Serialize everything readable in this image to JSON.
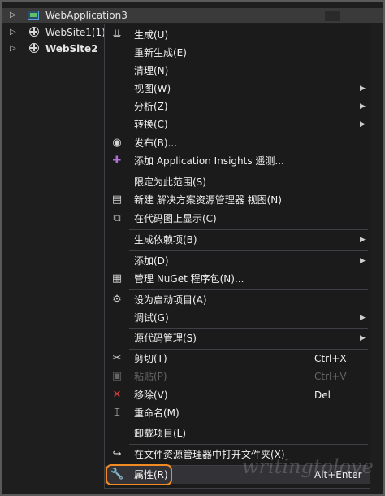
{
  "tree": {
    "app": "WebApplication3",
    "site1": "WebSite1(1)",
    "site2": "WebSite2"
  },
  "menu": {
    "build": "生成(U)",
    "rebuild": "重新生成(E)",
    "clean": "清理(N)",
    "view": "视图(W)",
    "analyze": "分析(Z)",
    "convert": "转换(C)",
    "publish": "发布(B)...",
    "insights": "添加 Application Insights 遥测...",
    "scope": "限定为此范围(S)",
    "new_view": "新建 解决方案资源管理器 视图(N)",
    "code_map": "在代码图上显示(C)",
    "build_deps": "生成依赖项(B)",
    "add": "添加(D)",
    "nuget": "管理 NuGet 程序包(N)...",
    "startup": "设为启动项目(A)",
    "debug": "调试(G)",
    "source_control": "源代码管理(S)",
    "cut": "剪切(T)",
    "cut_sc": "Ctrl+X",
    "paste": "粘贴(P)",
    "paste_sc": "Ctrl+V",
    "remove": "移除(V)",
    "remove_sc": "Del",
    "rename": "重命名(M)",
    "unload": "卸载项目(L)",
    "open_folder": "在文件资源管理器中打开文件夹(X)",
    "properties": "属性(R)",
    "properties_sc": "Alt+Enter"
  },
  "watermark": "writingtolove",
  "colors": {
    "menu_bg": "#1b1b1c",
    "accent_ring": "#f08a22",
    "remove_icon": "#e04040"
  }
}
